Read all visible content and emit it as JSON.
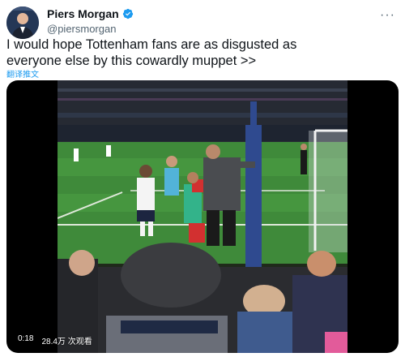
{
  "author": {
    "name": "Piers Morgan",
    "handle": "@piersmorgan",
    "verified_icon": "verified-badge-icon",
    "avatar_icon": "avatar-photo"
  },
  "tweet": {
    "text": "I would hope Tottenham fans are as disgusted as\neveryone else by this cowardly muppet >>",
    "translate_label": "翻译推文"
  },
  "more_menu": {
    "icon": "more-icon",
    "label": "···"
  },
  "video": {
    "time": "0:18",
    "views": "28.4万 次观看",
    "scene_icon": "stadium-video-still"
  },
  "colors": {
    "link": "#1d9bf0",
    "verified": "#1d9bf0",
    "text": "#0f1419",
    "secondary": "#536471"
  }
}
